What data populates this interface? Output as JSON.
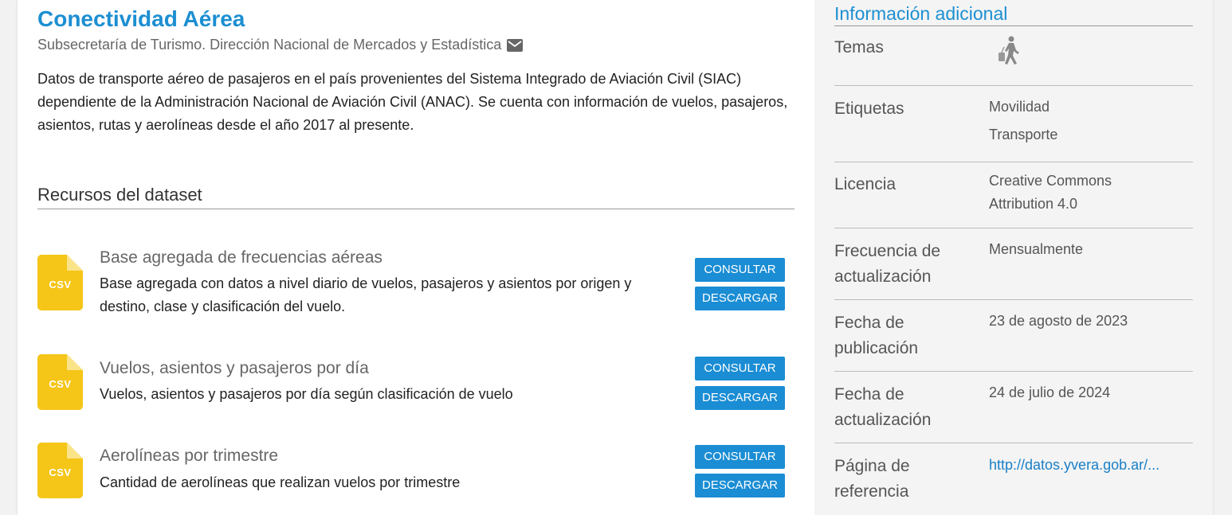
{
  "dataset": {
    "title": "Conectividad Aérea",
    "source": "Subsecretaría de Turismo. Dirección Nacional de Mercados y Estadística",
    "description": "Datos de transporte aéreo de pasajeros en el país provenientes del Sistema Integrado de Aviación Civil (SIAC) dependiente de la Administración Nacional de Aviación Civil (ANAC). Se cuenta con información de vuelos, pasajeros, asientos, rutas y aerolíneas desde el año 2017 al presente."
  },
  "resources": {
    "section_title": "Recursos del dataset",
    "items": [
      {
        "format": "CSV",
        "title": "Base agregada de frecuencias aéreas",
        "description": "Base agregada con datos a nivel diario de vuelos, pasajeros y asientos por origen y destino, clase y clasificación del vuelo.",
        "consult_label": "CONSULTAR",
        "download_label": "DESCARGAR"
      },
      {
        "format": "CSV",
        "title": "Vuelos, asientos y pasajeros por día",
        "description": "Vuelos, asientos y pasajeros por día según clasificación de vuelo",
        "consult_label": "CONSULTAR",
        "download_label": "DESCARGAR"
      },
      {
        "format": "CSV",
        "title": "Aerolíneas por trimestre",
        "description": "Cantidad de aerolíneas que realizan vuelos por trimestre",
        "consult_label": "CONSULTAR",
        "download_label": "DESCARGAR"
      }
    ]
  },
  "sidebar": {
    "title": "Información adicional",
    "topics_label": "Temas",
    "topics_icon": "traveler-with-suitcase-icon",
    "tags_label": "Etiquetas",
    "tags": [
      "Movilidad",
      "Transporte"
    ],
    "license_label": "Licencia",
    "license_lines": [
      "Creative Commons",
      "Attribution 4.0"
    ],
    "frequency_label_lines": [
      "Frecuencia de",
      "actualización"
    ],
    "frequency_value": "Mensualmente",
    "published_label_lines": [
      "Fecha de",
      "publicación"
    ],
    "published_value": "23 de agosto de 2023",
    "updated_label_lines": [
      "Fecha de",
      "actualización"
    ],
    "updated_value": "24 de julio de 2024",
    "reference_label_lines": [
      "Página de",
      "referencia"
    ],
    "reference_value": "http://datos.yvera.gob.ar/..."
  },
  "colors": {
    "accent": "#1c8fd2",
    "button": "#1a8dd4",
    "csv_icon": "#f5c518"
  }
}
